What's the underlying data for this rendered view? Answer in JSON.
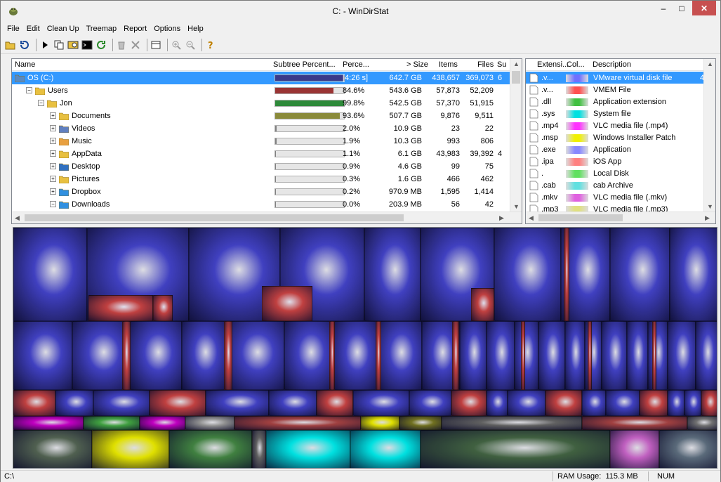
{
  "window": {
    "title": "C: - WinDirStat",
    "min_label": "–",
    "max_label": "□",
    "close_label": "✕"
  },
  "menu": [
    "File",
    "Edit",
    "Clean Up",
    "Treemap",
    "Report",
    "Options",
    "Help"
  ],
  "toolbar": {
    "icons": [
      "open-icon",
      "refresh-icon",
      "play-icon",
      "copy-icon",
      "explorer-icon",
      "cmd-icon",
      "refresh-selected-icon",
      "recycle-icon",
      "delete-icon",
      "properties-icon",
      "zoom-in-icon",
      "zoom-out-icon",
      "help-icon"
    ]
  },
  "tree": {
    "columns": [
      "Name",
      "Subtree Percent...",
      "Perce...",
      "> Size",
      "Items",
      "Files",
      "Su"
    ],
    "rows": [
      {
        "name": "OS (C:)",
        "level": 0,
        "toggle": "",
        "pct": "[4:26 s]",
        "pct_fill": 1.0,
        "bar_color": "#3a3a8a",
        "size": "642.7 GB",
        "items": "438,657",
        "files": "369,073",
        "sub": "6",
        "selected": true,
        "icon": "drive"
      },
      {
        "name": "Users",
        "level": 1,
        "toggle": "−",
        "pct": "84.6%",
        "pct_fill": 0.846,
        "bar_color": "#9a3434",
        "size": "543.6 GB",
        "items": "57,873",
        "files": "52,209",
        "sub": "",
        "selected": false,
        "icon": "folder"
      },
      {
        "name": "Jon",
        "level": 2,
        "toggle": "−",
        "pct": "99.8%",
        "pct_fill": 0.998,
        "bar_color": "#2e8a3a",
        "size": "542.5 GB",
        "items": "57,370",
        "files": "51,915",
        "sub": "",
        "selected": false,
        "icon": "folder-user"
      },
      {
        "name": "Documents",
        "level": 3,
        "toggle": "+",
        "pct": "93.6%",
        "pct_fill": 0.936,
        "bar_color": "#8a8a3a",
        "size": "507.7 GB",
        "items": "9,876",
        "files": "9,511",
        "sub": "",
        "selected": false,
        "icon": "folder-docs"
      },
      {
        "name": "Videos",
        "level": 3,
        "toggle": "+",
        "pct": "2.0%",
        "pct_fill": 0.02,
        "bar_color": "#808080",
        "size": "10.9 GB",
        "items": "23",
        "files": "22",
        "sub": "",
        "selected": false,
        "icon": "folder-video"
      },
      {
        "name": "Music",
        "level": 3,
        "toggle": "+",
        "pct": "1.9%",
        "pct_fill": 0.019,
        "bar_color": "#808080",
        "size": "10.3 GB",
        "items": "993",
        "files": "806",
        "sub": "",
        "selected": false,
        "icon": "folder-music"
      },
      {
        "name": "AppData",
        "level": 3,
        "toggle": "+",
        "pct": "1.1%",
        "pct_fill": 0.011,
        "bar_color": "#808080",
        "size": "6.1 GB",
        "items": "43,983",
        "files": "39,392",
        "sub": "4",
        "selected": false,
        "icon": "folder"
      },
      {
        "name": "Desktop",
        "level": 3,
        "toggle": "+",
        "pct": "0.9%",
        "pct_fill": 0.009,
        "bar_color": "#808080",
        "size": "4.6 GB",
        "items": "99",
        "files": "75",
        "sub": "",
        "selected": false,
        "icon": "folder-desktop"
      },
      {
        "name": "Pictures",
        "level": 3,
        "toggle": "+",
        "pct": "0.3%",
        "pct_fill": 0.003,
        "bar_color": "#808080",
        "size": "1.6 GB",
        "items": "466",
        "files": "462",
        "sub": "",
        "selected": false,
        "icon": "folder-pictures"
      },
      {
        "name": "Dropbox",
        "level": 3,
        "toggle": "+",
        "pct": "0.2%",
        "pct_fill": 0.002,
        "bar_color": "#808080",
        "size": "970.9 MB",
        "items": "1,595",
        "files": "1,414",
        "sub": "",
        "selected": false,
        "icon": "folder-dropbox"
      },
      {
        "name": "Downloads",
        "level": 3,
        "toggle": "−",
        "pct": "0.0%",
        "pct_fill": 0.0,
        "bar_color": "#808080",
        "size": "203.9 MB",
        "items": "56",
        "files": "42",
        "sub": "",
        "selected": false,
        "icon": "folder-downloads"
      }
    ]
  },
  "extensions": {
    "columns": [
      "Extensi...",
      "Col...",
      "Description"
    ],
    "rows": [
      {
        "ext": ".v...",
        "color": "#7070ff",
        "desc": "VMware virtual disk file",
        "extra": "4",
        "selected": true,
        "icon": "vmdk-icon"
      },
      {
        "ext": ".v...",
        "color": "#ff5050",
        "desc": "VMEM File",
        "extra": "",
        "selected": false,
        "icon": "file-icon"
      },
      {
        "ext": ".dll",
        "color": "#40c040",
        "desc": "Application extension",
        "extra": "",
        "selected": false,
        "icon": "dll-icon"
      },
      {
        "ext": ".sys",
        "color": "#00e0e0",
        "desc": "System file",
        "extra": "",
        "selected": false,
        "icon": "sys-icon"
      },
      {
        "ext": ".mp4",
        "color": "#ff30ff",
        "desc": "VLC media file (.mp4)",
        "extra": "",
        "selected": false,
        "icon": "vlc-icon"
      },
      {
        "ext": ".msp",
        "color": "#f0f000",
        "desc": "Windows Installer Patch",
        "extra": "",
        "selected": false,
        "icon": "msp-icon"
      },
      {
        "ext": ".exe",
        "color": "#8888ff",
        "desc": "Application",
        "extra": "",
        "selected": false,
        "icon": "exe-icon"
      },
      {
        "ext": ".ipa",
        "color": "#ff8080",
        "desc": "iOS App",
        "extra": "",
        "selected": false,
        "icon": "ipa-icon"
      },
      {
        "ext": ".",
        "color": "#60e060",
        "desc": "Local Disk",
        "extra": "",
        "selected": false,
        "icon": "disk-icon"
      },
      {
        "ext": ".cab",
        "color": "#60e0e0",
        "desc": "cab Archive",
        "extra": "",
        "selected": false,
        "icon": "cab-icon"
      },
      {
        "ext": ".mkv",
        "color": "#e060e0",
        "desc": "VLC media file (.mkv)",
        "extra": "",
        "selected": false,
        "icon": "vlc-icon"
      },
      {
        "ext": ".mp3",
        "color": "#e0e080",
        "desc": "VLC media file (.mp3)",
        "extra": "",
        "selected": false,
        "icon": "vlc-icon"
      }
    ]
  },
  "status": {
    "path": "C:\\",
    "ram_label": "RAM Usage:",
    "ram_value": "115.3 MB",
    "num": "NUM"
  },
  "colors": {
    "selection": "#3399ff",
    "treemap_blue": "#4040c0",
    "treemap_red": "#c04040",
    "treemap_cyan": "#00e0e0",
    "treemap_yellow": "#e0e000",
    "treemap_green": "#40a040",
    "treemap_magenta": "#c000c0"
  }
}
